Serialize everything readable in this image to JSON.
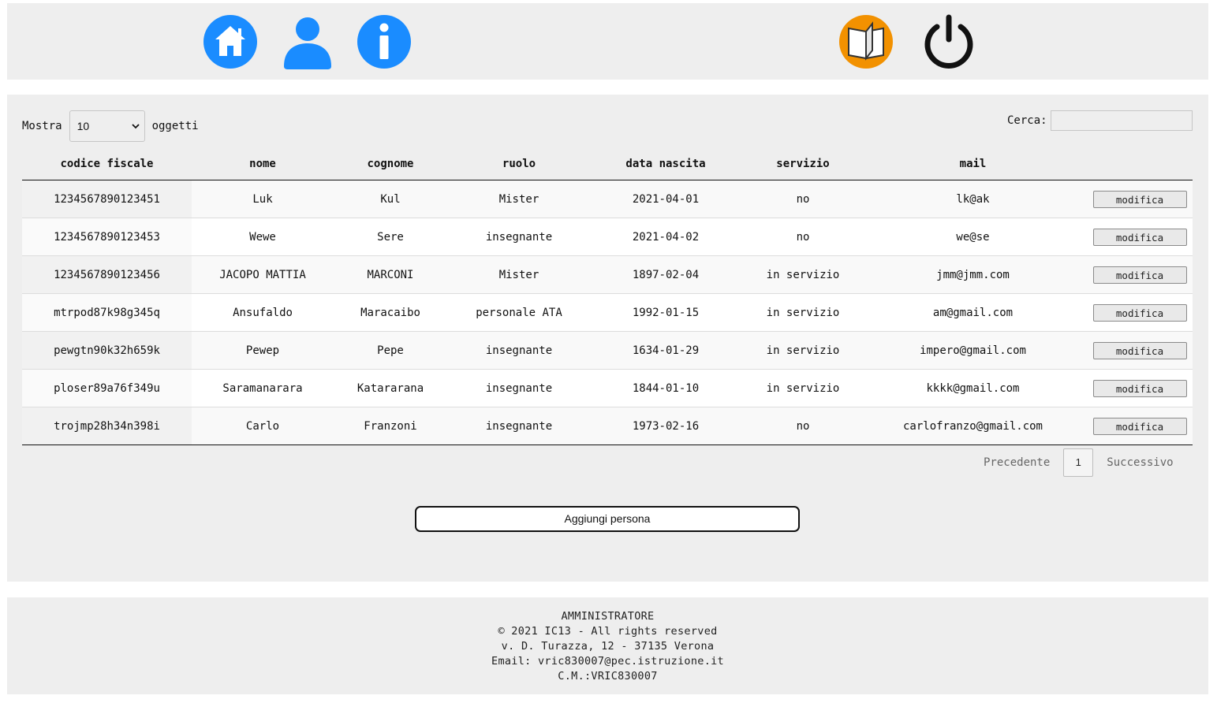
{
  "colors": {
    "icon_blue": "#1a8cff",
    "book_orange": "#f29100",
    "power_black": "#111111",
    "panel_bg": "#eeeeee"
  },
  "nav": {
    "home_icon": "home-icon",
    "user_icon": "user-icon",
    "info_icon": "info-icon",
    "book_icon": "book-icon",
    "power_icon": "power-icon"
  },
  "controls": {
    "show_label": "Mostra",
    "page_size": "10",
    "items_label": "oggetti",
    "search_label": "Cerca:",
    "search_value": ""
  },
  "table": {
    "headers": [
      "codice fiscale",
      "nome",
      "cognome",
      "ruolo",
      "data nascita",
      "servizio",
      "mail",
      ""
    ],
    "rows": [
      {
        "codice": "1234567890123451",
        "nome": "Luk",
        "cognome": "Kul",
        "ruolo": "Mister",
        "data": "2021-04-01",
        "servizio": "no",
        "mail": "lk@ak",
        "action": "modifica"
      },
      {
        "codice": "1234567890123453",
        "nome": "Wewe",
        "cognome": "Sere",
        "ruolo": "insegnante",
        "data": "2021-04-02",
        "servizio": "no",
        "mail": "we@se",
        "action": "modifica"
      },
      {
        "codice": "1234567890123456",
        "nome": "JACOPO MATTIA",
        "cognome": "MARCONI",
        "ruolo": "Mister",
        "data": "1897-02-04",
        "servizio": "in servizio",
        "mail": "jmm@jmm.com",
        "action": "modifica"
      },
      {
        "codice": "mtrpod87k98g345q",
        "nome": "Ansufaldo",
        "cognome": "Maracaibo",
        "ruolo": "personale ATA",
        "data": "1992-01-15",
        "servizio": "in servizio",
        "mail": "am@gmail.com",
        "action": "modifica"
      },
      {
        "codice": "pewgtn90k32h659k",
        "nome": "Pewep",
        "cognome": "Pepe",
        "ruolo": "insegnante",
        "data": "1634-01-29",
        "servizio": "in servizio",
        "mail": "impero@gmail.com",
        "action": "modifica"
      },
      {
        "codice": "ploser89a76f349u",
        "nome": "Saramanarara",
        "cognome": "Katararana",
        "ruolo": "insegnante",
        "data": "1844-01-10",
        "servizio": "in servizio",
        "mail": "kkkk@gmail.com",
        "action": "modifica"
      },
      {
        "codice": "trojmp28h34n398i",
        "nome": "Carlo",
        "cognome": "Franzoni",
        "ruolo": "insegnante",
        "data": "1973-02-16",
        "servizio": "no",
        "mail": "carlofranzo@gmail.com",
        "action": "modifica"
      }
    ]
  },
  "pager": {
    "prev": "Precedente",
    "page": "1",
    "next": "Successivo"
  },
  "add_button": "Aggiungi persona",
  "footer": {
    "line1": "AMMINISTRATORE",
    "line2": "© 2021 IC13 - All rights reserved",
    "line3": "v. D. Turazza, 12 - 37135 Verona",
    "line4": "Email: vric830007@pec.istruzione.it",
    "line5": "C.M.:VRIC830007"
  }
}
